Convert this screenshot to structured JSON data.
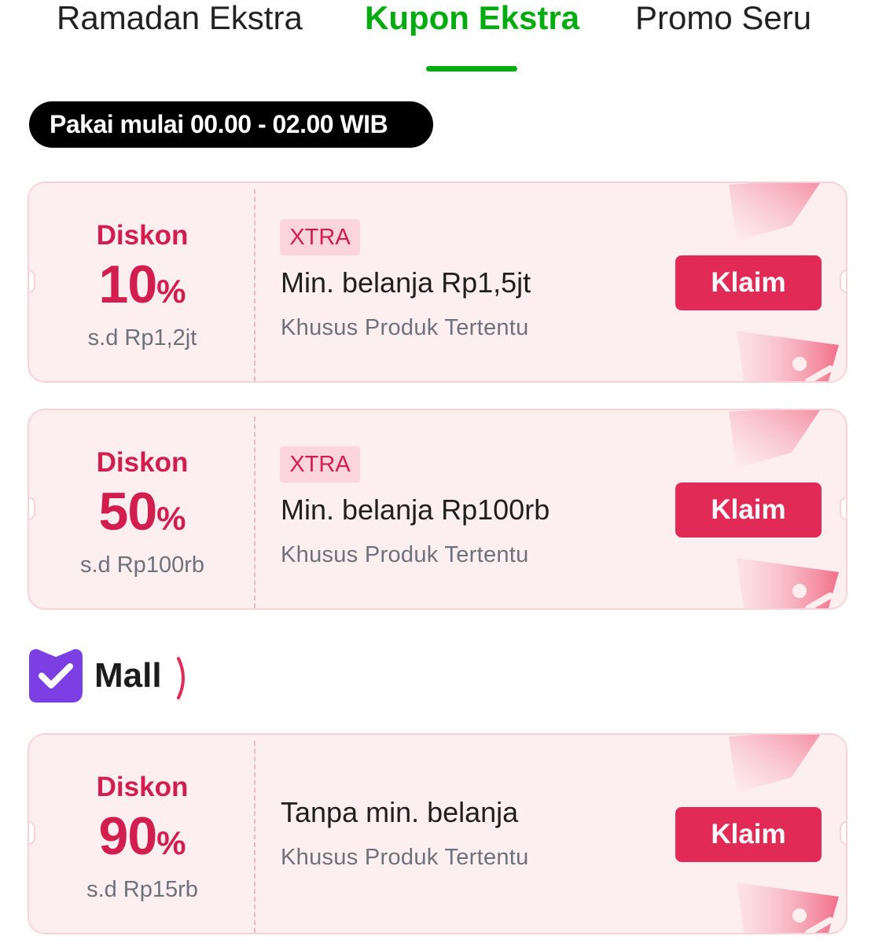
{
  "tabs": [
    {
      "label": "Ramadan Ekstra",
      "active": false
    },
    {
      "label": "Kupon Ekstra",
      "active": true
    },
    {
      "label": "Promo Seru",
      "active": false
    }
  ],
  "time_badge": "Pakai mulai 00.00 - 02.00 WIB",
  "mall": {
    "label": "Mall",
    "icon": "mall-check-icon"
  },
  "colors": {
    "accent_green": "#03ac0e",
    "coupon_red": "#d21e4f",
    "button_red": "#e22a57",
    "coupon_bg": "#fdeef0"
  },
  "coupons": [
    {
      "diskon_label": "Diskon",
      "percent": "10",
      "percent_symbol": "%",
      "max": "s.d Rp1,2jt",
      "badge": "XTRA",
      "min_purchase": "Min. belanja Rp1,5jt",
      "description": "Khusus Produk Tertentu",
      "button": "Klaim"
    },
    {
      "diskon_label": "Diskon",
      "percent": "50",
      "percent_symbol": "%",
      "max": "s.d Rp100rb",
      "badge": "XTRA",
      "min_purchase": "Min. belanja Rp100rb",
      "description": "Khusus Produk Tertentu",
      "button": "Klaim"
    },
    {
      "diskon_label": "Diskon",
      "percent": "90",
      "percent_symbol": "%",
      "max": "s.d Rp15rb",
      "min_purchase": "Tanpa min. belanja",
      "description": "Khusus Produk Tertentu",
      "button": "Klaim"
    }
  ]
}
